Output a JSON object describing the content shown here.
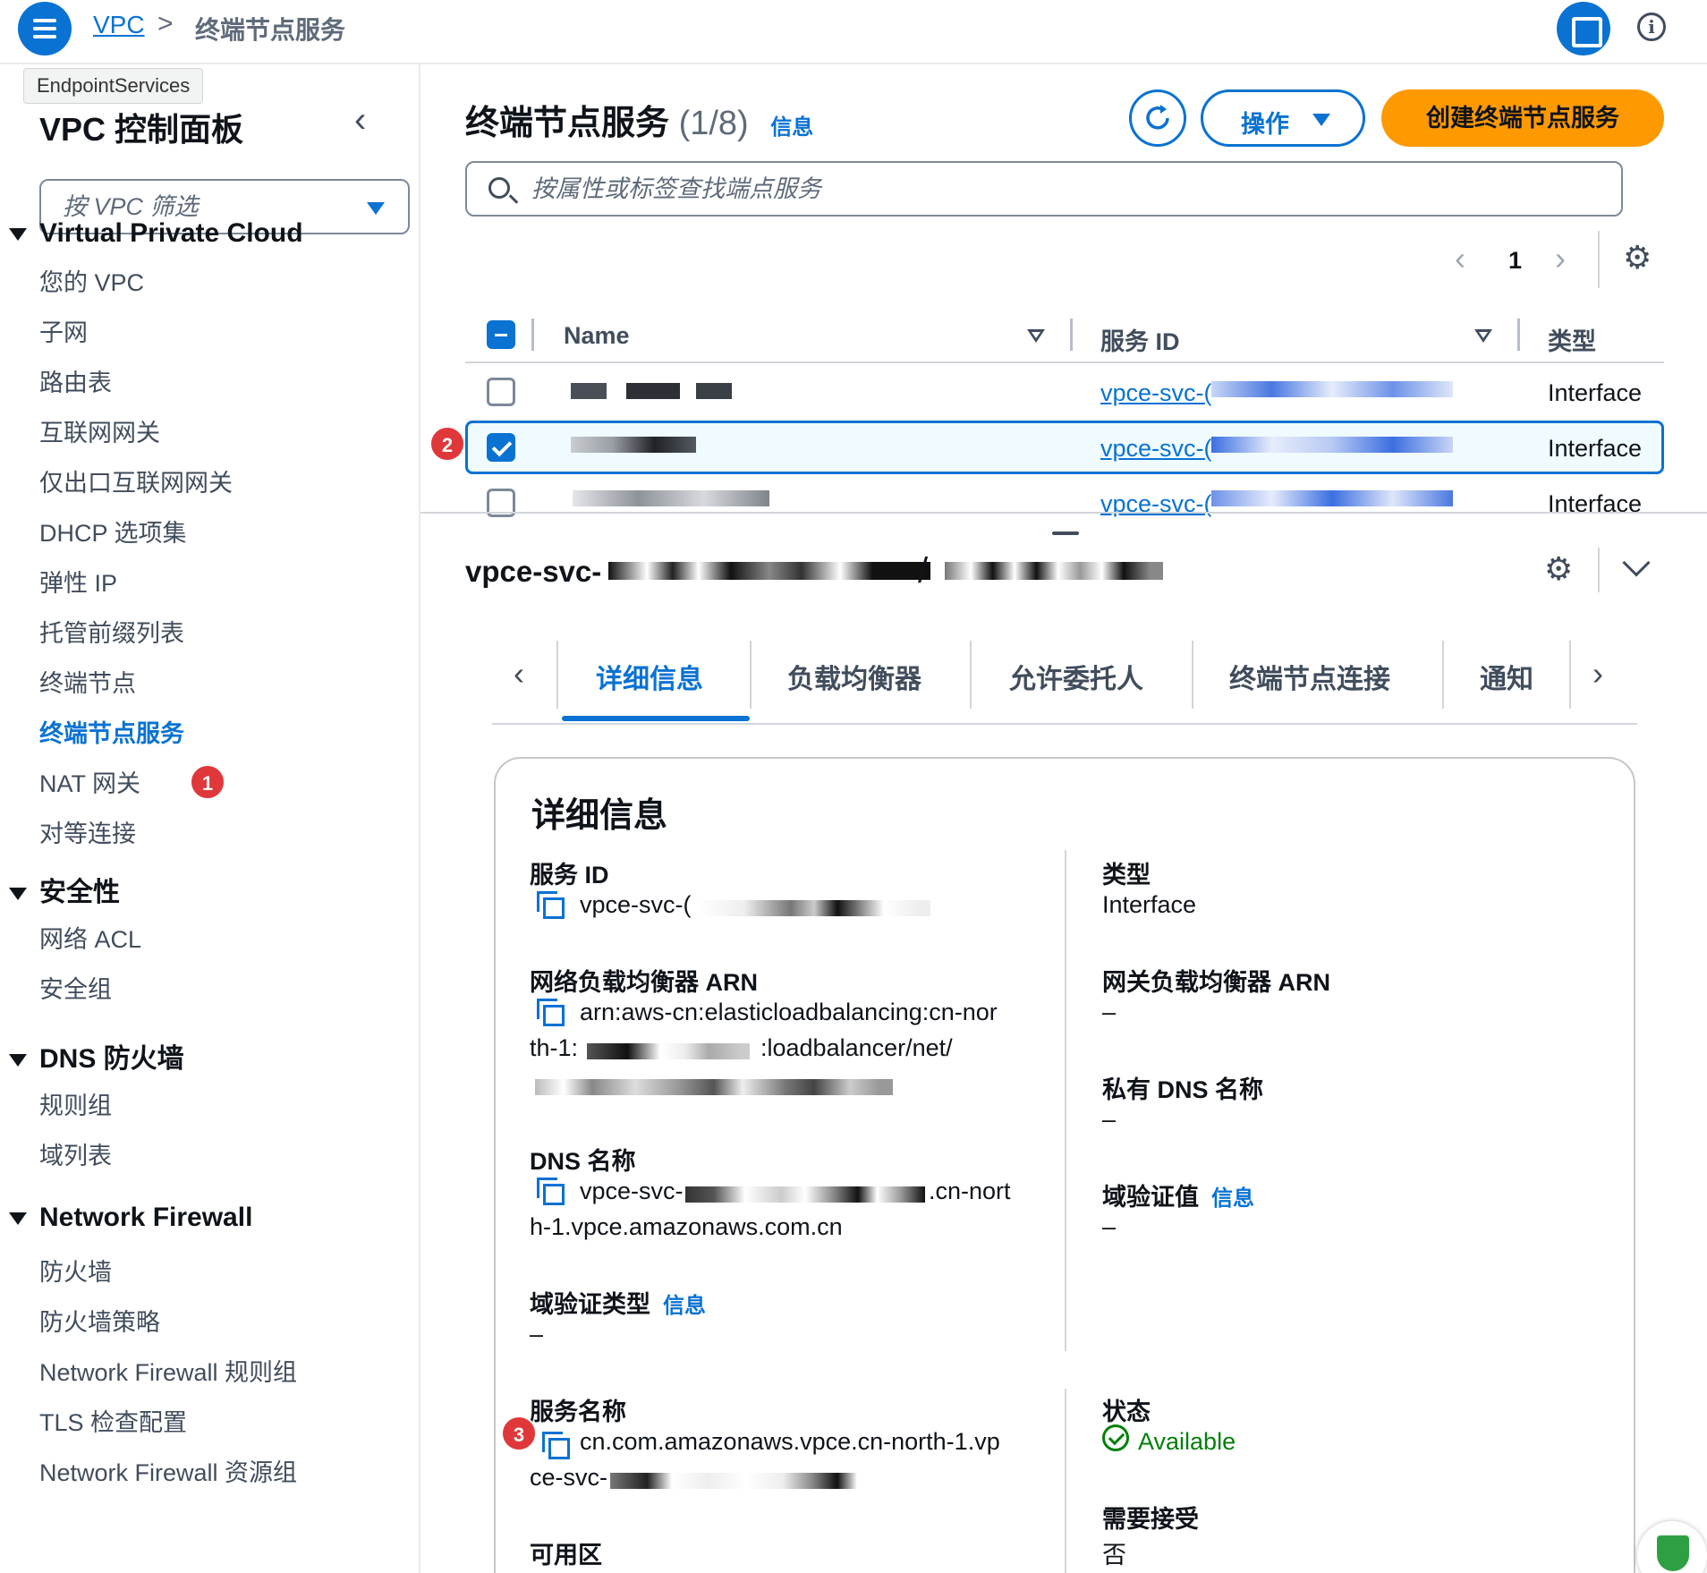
{
  "topbar": {
    "breadcrumb_link": "VPC",
    "breadcrumb_sep": ">",
    "breadcrumb_current": "终端节点服务"
  },
  "sidebar": {
    "tooltip": "EndpointServices",
    "title": "VPC 控制面板",
    "filter_placeholder": "按 VPC 筛选",
    "sections": [
      {
        "title": "Virtual Private Cloud",
        "items": [
          "您的 VPC",
          "子网",
          "路由表",
          "互联网网关",
          "仅出口互联网网关",
          "DHCP 选项集",
          "弹性 IP",
          "托管前缀列表",
          "终端节点",
          "终端节点服务",
          "NAT 网关",
          "对等连接"
        ]
      },
      {
        "title": "安全性",
        "items": [
          "网络 ACL",
          "安全组"
        ]
      },
      {
        "title": "DNS 防火墙",
        "items": [
          "规则组",
          "域列表"
        ]
      },
      {
        "title": "Network Firewall",
        "items": [
          "防火墙",
          "防火墙策略",
          "Network Firewall 规则组",
          "TLS 检查配置",
          "Network Firewall 资源组"
        ]
      }
    ],
    "active_item": "终端节点服务"
  },
  "badges": {
    "one": "1",
    "two": "2",
    "three": "3"
  },
  "main": {
    "title": "终端节点服务",
    "count": "(1/8)",
    "info": "信息",
    "actions_label": "操作",
    "create_label": "创建终端节点服务",
    "search_placeholder": "按属性或标签查找端点服务",
    "page": "1",
    "columns": [
      "Name",
      "服务 ID",
      "类型"
    ],
    "rows": [
      {
        "service_id": "vpce-svc-(",
        "type": "Interface",
        "selected": false
      },
      {
        "service_id": "vpce-svc-(",
        "type": "Interface",
        "selected": true
      },
      {
        "service_id": "vpce-svc-(",
        "type": "Interface",
        "selected": false
      }
    ]
  },
  "detail": {
    "title": "vpce-svc-",
    "title_sep": "/",
    "tabs": [
      "详细信息",
      "负载均衡器",
      "允许委托人",
      "终端节点连接",
      "通知"
    ],
    "card_title": "详细信息",
    "fields": {
      "service_id_label": "服务 ID",
      "service_id_value": "vpce-svc-(",
      "type_label": "类型",
      "type_value": "Interface",
      "nlb_arn_label": "网络负载均衡器 ARN",
      "nlb_arn_line1": "arn:aws-cn:elasticloadbalancing:cn-nor",
      "nlb_arn_line2a": "th-1:",
      "nlb_arn_line2b": ":loadbalancer/net/",
      "gwlb_arn_label": "网关负载均衡器 ARN",
      "gwlb_arn_value": "–",
      "private_dns_label": "私有 DNS 名称",
      "private_dns_value": "–",
      "dns_name_label": "DNS 名称",
      "dns_name_line1a": "vpce-svc-",
      "dns_name_line1b": ".cn-nort",
      "dns_name_line2": "h-1.vpce.amazonaws.com.cn",
      "domain_verify_value_label": "域验证值",
      "domain_verify_value": "–",
      "domain_verify_type_label": "域验证类型",
      "domain_verify_type_value": "–",
      "service_name_label": "服务名称",
      "service_name_line1": "cn.com.amazonaws.vpce.cn-north-1.vp",
      "service_name_line2": "ce-svc-",
      "status_label": "状态",
      "status_value": "Available",
      "acceptance_label": "需要接受",
      "acceptance_value": "否",
      "az_label": "可用区"
    }
  },
  "colors": {
    "accent": "#0972d3",
    "primary_button": "#ff9900",
    "success": "#037f0c",
    "badge": "#e0373a"
  }
}
